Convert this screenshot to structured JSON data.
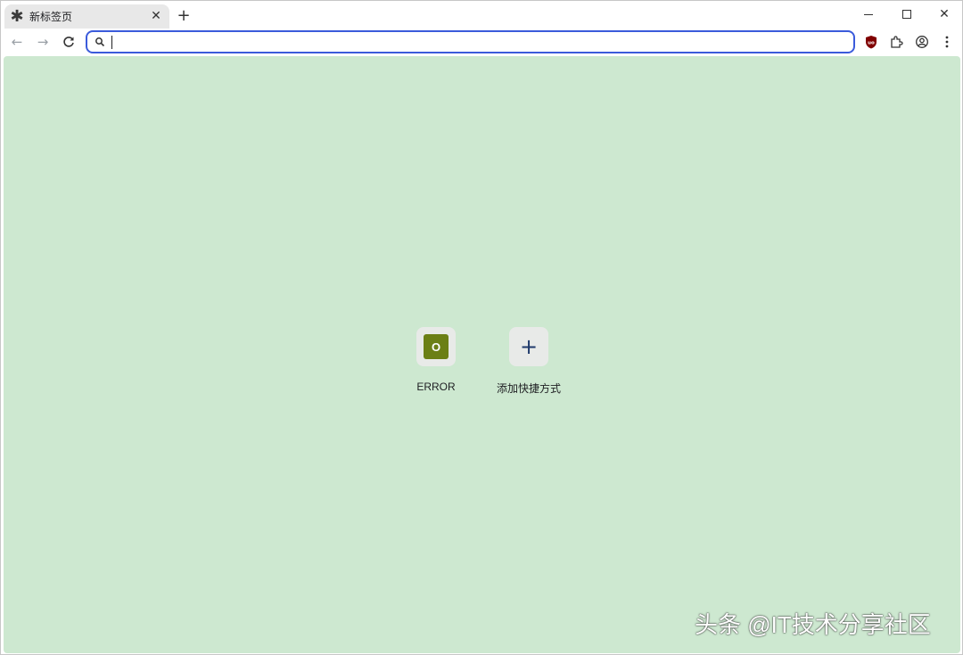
{
  "tab": {
    "title": "新标签页",
    "favicon": "asterisk-icon",
    "close_glyph": "✕"
  },
  "new_tab_glyph": "+",
  "window_controls": {
    "close_glyph": "✕"
  },
  "toolbar": {
    "back_glyph": "←",
    "forward_glyph": "→",
    "reload_glyph": "C",
    "omnibox_value": ""
  },
  "shortcuts": [
    {
      "label": "ERROR",
      "favicon_letter": "O",
      "favicon_color": "#6b7f15"
    },
    {
      "label": "添加快捷方式",
      "glyph": "+"
    }
  ],
  "content_background": "#cde8d0",
  "omnibox_focus_color": "#3b5bdb",
  "watermark": "头条 @IT技术分享社区"
}
